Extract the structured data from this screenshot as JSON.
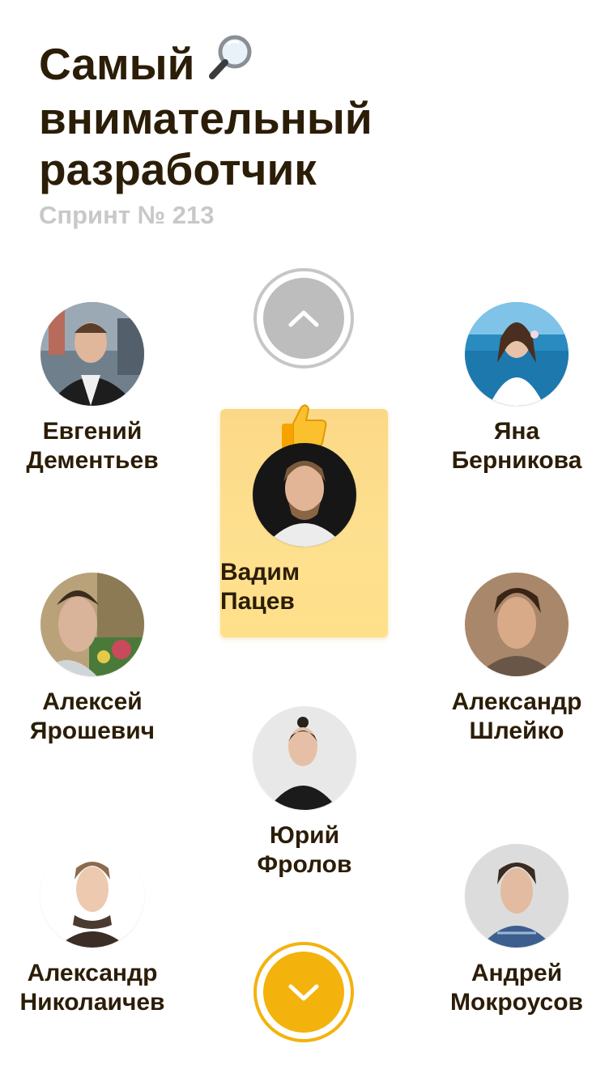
{
  "header": {
    "title_lines": [
      "Самый",
      "внимательный",
      "разработчик"
    ],
    "title_icon": "magnifier-icon",
    "subtitle": "Спринт № 213"
  },
  "leader": {
    "badge_icon": "thumbs-up-icon",
    "first_name": "Вадим",
    "last_name": "Пацев"
  },
  "people": [
    {
      "first_name": "Евгений",
      "last_name": "Дементьев"
    },
    {
      "first_name": "Яна",
      "last_name": "Берникова"
    },
    {
      "first_name": "Алексей",
      "last_name": "Ярошевич"
    },
    {
      "first_name": "Александр",
      "last_name": "Шлейко"
    },
    {
      "first_name": "Юрий",
      "last_name": "Фролов"
    },
    {
      "first_name": "Александр",
      "last_name": "Николаичев"
    },
    {
      "first_name": "Андрей",
      "last_name": "Мокроусов"
    }
  ],
  "navigation": {
    "up_icon": "chevron-up-icon",
    "down_icon": "chevron-down-icon"
  },
  "colors": {
    "text": "#2b1d07",
    "subtitle": "#c8c8c8",
    "accent": "#f4b20c",
    "disabled": "#bdbdbd",
    "card": "#fde08f"
  }
}
